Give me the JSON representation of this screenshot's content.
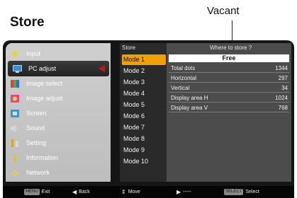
{
  "title": "Store",
  "callout": "Vacant",
  "sidebar": {
    "items": [
      {
        "label": "Input",
        "icon": "input-icon"
      },
      {
        "label": "PC adjust",
        "icon": "monitor-icon",
        "selected": true
      },
      {
        "label": "Image select",
        "icon": "image-select-icon"
      },
      {
        "label": "Image adjust",
        "icon": "image-adjust-icon"
      },
      {
        "label": "Screen",
        "icon": "screen-icon"
      },
      {
        "label": "Sound",
        "icon": "sound-icon"
      },
      {
        "label": "Setting",
        "icon": "setting-icon"
      },
      {
        "label": "Information",
        "icon": "information-icon"
      },
      {
        "label": "Network",
        "icon": "network-icon"
      }
    ]
  },
  "store_panel": {
    "header": "Store",
    "where_label": "Where to store ?",
    "modes": [
      "Mode 1",
      "Mode 2",
      "Mode 3",
      "Mode 4",
      "Mode 5",
      "Mode 6",
      "Mode 7",
      "Mode 8",
      "Mode 9",
      "Mode 10"
    ],
    "status": "Free",
    "rows": [
      {
        "label": "Total dots",
        "value": "1344"
      },
      {
        "label": "Horizontal",
        "value": "297"
      },
      {
        "label": "Vertical",
        "value": "34"
      },
      {
        "label": "Display area H",
        "value": "1024"
      },
      {
        "label": "Display area V",
        "value": "768"
      }
    ]
  },
  "bottom_bar": {
    "exit_key": "MENU",
    "exit_label": "Exit",
    "back_label": "Back",
    "move_label": "Move",
    "select_placeholder": "-----",
    "select_key": "SELECT",
    "select_label": "Select"
  },
  "colors": {
    "selected_mode": "#f0a000",
    "arrow_red": "#d0101a"
  }
}
